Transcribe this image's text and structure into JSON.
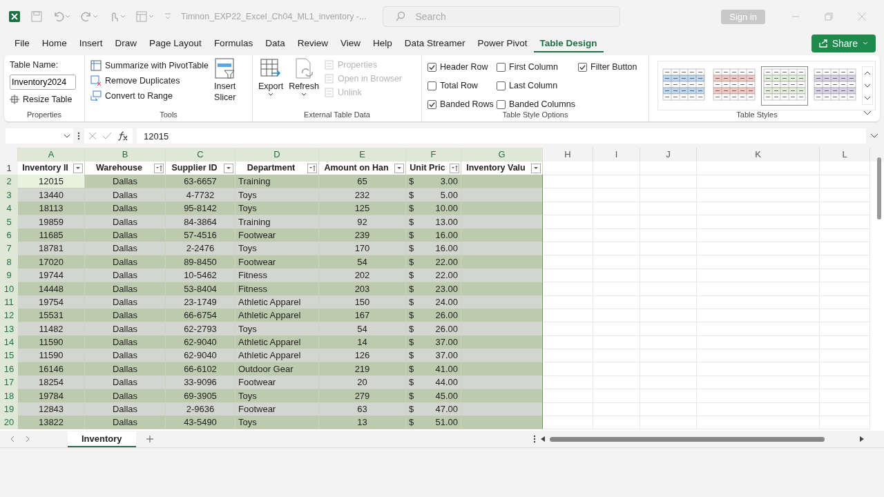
{
  "window": {
    "title": "Timnon_EXP22_Excel_Ch04_ML1_inventory  -...",
    "search_placeholder": "Search",
    "sign_in": "Sign in"
  },
  "menu_tabs": [
    {
      "label": "File",
      "selected": false
    },
    {
      "label": "Home",
      "selected": false
    },
    {
      "label": "Insert",
      "selected": false
    },
    {
      "label": "Draw",
      "selected": false
    },
    {
      "label": "Page Layout",
      "selected": false
    },
    {
      "label": "Formulas",
      "selected": false
    },
    {
      "label": "Data",
      "selected": false
    },
    {
      "label": "Review",
      "selected": false
    },
    {
      "label": "View",
      "selected": false
    },
    {
      "label": "Help",
      "selected": false
    },
    {
      "label": "Data Streamer",
      "selected": false
    },
    {
      "label": "Power Pivot",
      "selected": false
    },
    {
      "label": "Table Design",
      "selected": true
    }
  ],
  "share": "Share",
  "ribbon": {
    "properties": {
      "label": "Table Name:",
      "value": "Inventory2024",
      "resize": "Resize Table",
      "group": "Properties"
    },
    "tools": {
      "items": [
        "Summarize with PivotTable",
        "Remove Duplicates",
        "Convert to Range"
      ],
      "slicer": [
        "Insert",
        "Slicer"
      ],
      "group": "Tools"
    },
    "external": {
      "export": "Export",
      "refresh": "Refresh",
      "items": [
        {
          "label": "Properties",
          "disabled": true
        },
        {
          "label": "Open in Browser",
          "disabled": true
        },
        {
          "label": "Unlink",
          "disabled": true
        }
      ],
      "group": "External Table Data"
    },
    "style_options": {
      "options": [
        {
          "label": "Header Row",
          "checked": true
        },
        {
          "label": "Total Row",
          "checked": false
        },
        {
          "label": "Banded Rows",
          "checked": true
        },
        {
          "label": "First Column",
          "checked": false
        },
        {
          "label": "Last Column",
          "checked": false
        },
        {
          "label": "Banded Columns",
          "checked": false
        },
        {
          "label": "Filter Button",
          "checked": true
        }
      ],
      "group": "Table Style Options"
    },
    "styles": {
      "thumbs": [
        {
          "color": "#bdd7ee",
          "selected": false
        },
        {
          "color": "#f4c7c3",
          "selected": false
        },
        {
          "color": "#e2efd9",
          "selected": true
        },
        {
          "color": "#d9d2e9",
          "selected": false
        }
      ],
      "group": "Table Styles"
    }
  },
  "formula_bar": {
    "value": "12015"
  },
  "columns": [
    "A",
    "B",
    "C",
    "D",
    "E",
    "F",
    "G",
    "H",
    "I",
    "J",
    "K",
    "L"
  ],
  "headers": [
    {
      "label": "Inventory II",
      "kind": "filter"
    },
    {
      "label": "Warehouse",
      "kind": "sorted"
    },
    {
      "label": "Supplier ID",
      "kind": "filter"
    },
    {
      "label": "Department",
      "kind": "sorted"
    },
    {
      "label": "Amount on Han",
      "kind": "filter"
    },
    {
      "label": "Unit Pric",
      "kind": "sorted"
    },
    {
      "label": "Inventory Valu",
      "kind": "filter"
    }
  ],
  "rows": [
    {
      "n": "1"
    },
    {
      "n": "2",
      "active": true,
      "cells": [
        "12015",
        "Dallas",
        "63-6657",
        "Training",
        "65",
        "$",
        "3.00"
      ]
    },
    {
      "n": "3",
      "active": false,
      "cells": [
        "13440",
        "Dallas",
        "4-7732",
        "Toys",
        "232",
        "$",
        "5.00"
      ]
    },
    {
      "n": "4",
      "active": false,
      "cells": [
        "18113",
        "Dallas",
        "95-8142",
        "Toys",
        "125",
        "$",
        "10.00"
      ]
    },
    {
      "n": "5",
      "active": false,
      "cells": [
        "19859",
        "Dallas",
        "84-3864",
        "Training",
        "92",
        "$",
        "13.00"
      ]
    },
    {
      "n": "6",
      "active": false,
      "cells": [
        "11685",
        "Dallas",
        "57-4516",
        "Footwear",
        "239",
        "$",
        "16.00"
      ]
    },
    {
      "n": "7",
      "active": false,
      "cells": [
        "18781",
        "Dallas",
        "2-2476",
        "Toys",
        "170",
        "$",
        "16.00"
      ]
    },
    {
      "n": "8",
      "active": false,
      "cells": [
        "17020",
        "Dallas",
        "89-8450",
        "Footwear",
        "54",
        "$",
        "22.00"
      ]
    },
    {
      "n": "9",
      "active": false,
      "cells": [
        "19744",
        "Dallas",
        "10-5462",
        "Fitness",
        "202",
        "$",
        "22.00"
      ]
    },
    {
      "n": "10",
      "active": false,
      "cells": [
        "14448",
        "Dallas",
        "53-8404",
        "Fitness",
        "203",
        "$",
        "23.00"
      ]
    },
    {
      "n": "11",
      "active": false,
      "cells": [
        "19754",
        "Dallas",
        "23-1749",
        "Athletic Apparel",
        "150",
        "$",
        "24.00"
      ]
    },
    {
      "n": "12",
      "active": false,
      "cells": [
        "15531",
        "Dallas",
        "66-6754",
        "Athletic Apparel",
        "167",
        "$",
        "26.00"
      ]
    },
    {
      "n": "13",
      "active": false,
      "cells": [
        "11482",
        "Dallas",
        "62-2793",
        "Toys",
        "54",
        "$",
        "26.00"
      ]
    },
    {
      "n": "14",
      "active": false,
      "cells": [
        "11590",
        "Dallas",
        "62-9040",
        "Athletic Apparel",
        "14",
        "$",
        "37.00"
      ]
    },
    {
      "n": "15",
      "active": false,
      "cells": [
        "11590",
        "Dallas",
        "62-9040",
        "Athletic Apparel",
        "126",
        "$",
        "37.00"
      ]
    },
    {
      "n": "16",
      "active": false,
      "cells": [
        "16146",
        "Dallas",
        "66-6102",
        "Outdoor Gear",
        "219",
        "$",
        "41.00"
      ]
    },
    {
      "n": "17",
      "active": false,
      "cells": [
        "18254",
        "Dallas",
        "33-9096",
        "Footwear",
        "20",
        "$",
        "44.00"
      ]
    },
    {
      "n": "18",
      "active": false,
      "cells": [
        "19784",
        "Dallas",
        "69-3905",
        "Toys",
        "279",
        "$",
        "45.00"
      ]
    },
    {
      "n": "19",
      "active": false,
      "cells": [
        "12843",
        "Dallas",
        "2-9636",
        "Footwear",
        "63",
        "$",
        "47.00"
      ]
    },
    {
      "n": "20",
      "active": false,
      "cells": [
        "13822",
        "Dallas",
        "43-5490",
        "Toys",
        "13",
        "$",
        "51.00"
      ]
    }
  ],
  "sheets": [
    {
      "label": "Inventory",
      "selected": true
    }
  ]
}
